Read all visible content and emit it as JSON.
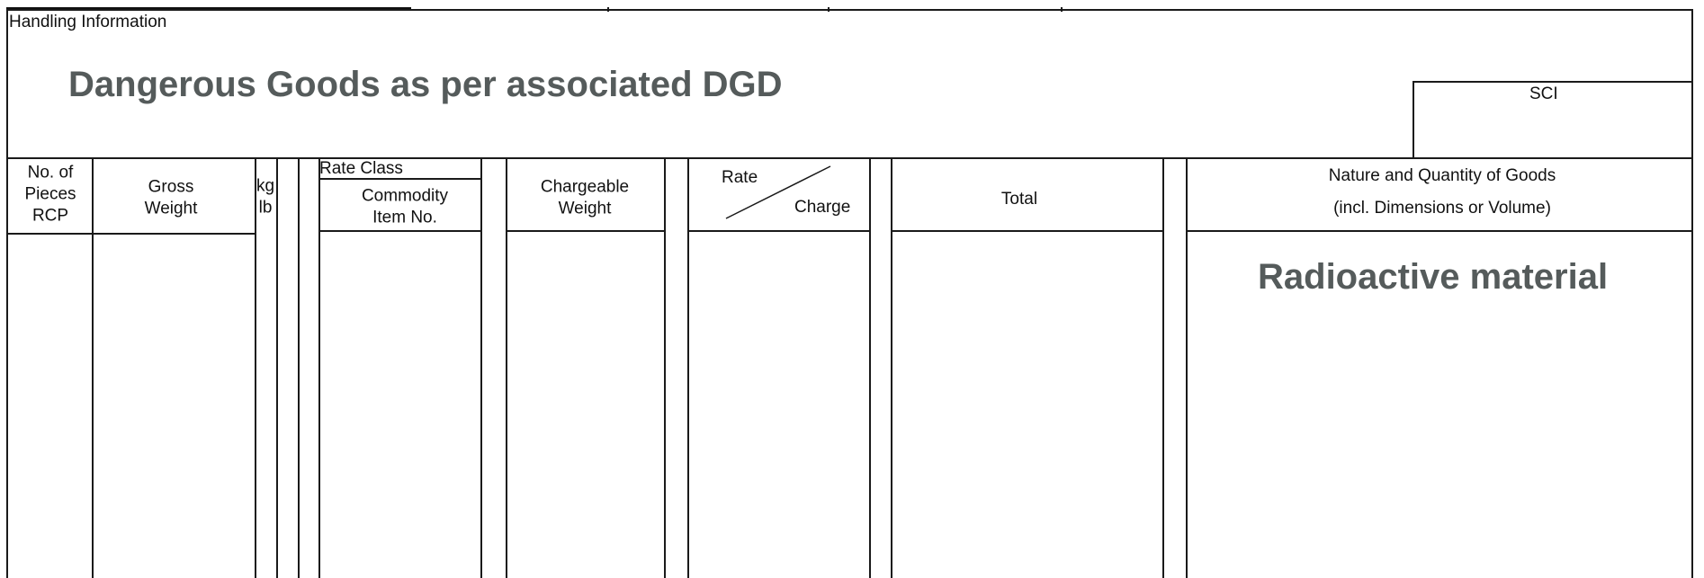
{
  "handling": {
    "label": "Handling Information",
    "text": "Dangerous Goods as per associated DGD",
    "sci_label": "SCI"
  },
  "columns": {
    "pieces": [
      "No. of",
      "Pieces",
      "RCP"
    ],
    "gross_weight": [
      "Gross",
      "Weight"
    ],
    "unit": [
      "kg",
      "lb"
    ],
    "rate_class": "Rate Class",
    "commodity": [
      "Commodity",
      "Item No."
    ],
    "chargeable_weight": [
      "Chargeable",
      "Weight"
    ],
    "rate": "Rate",
    "charge": "Charge",
    "total": "Total",
    "nature": [
      "Nature and Quantity of Goods",
      "(incl. Dimensions or Volume)"
    ]
  },
  "nature_value": "Radioactive material"
}
